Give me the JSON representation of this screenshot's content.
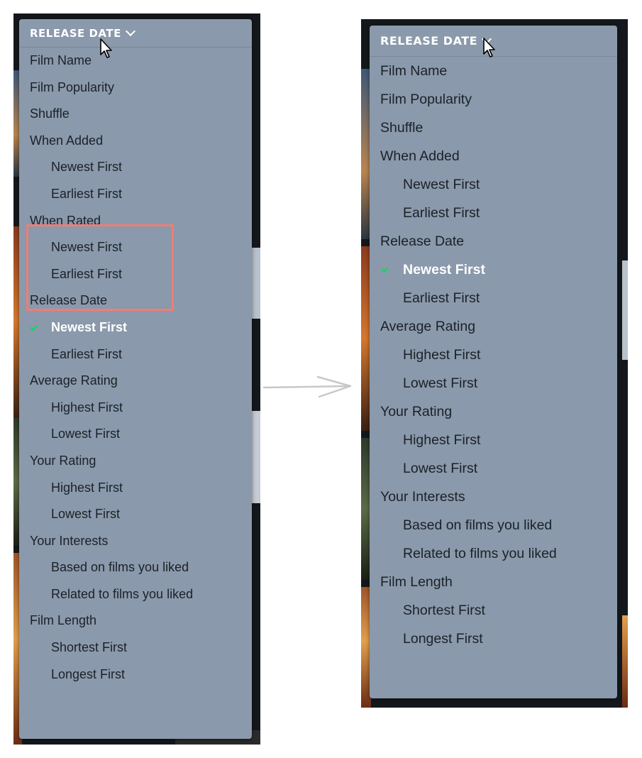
{
  "left_panel": {
    "header_label": "RELEASE DATE",
    "items": [
      {
        "label": "Film Name",
        "type": "group"
      },
      {
        "label": "Film Popularity",
        "type": "group"
      },
      {
        "label": "Shuffle",
        "type": "group"
      },
      {
        "label": "When Added",
        "type": "group"
      },
      {
        "label": "Newest First",
        "type": "sub"
      },
      {
        "label": "Earliest First",
        "type": "sub"
      },
      {
        "label": "When Rated",
        "type": "group"
      },
      {
        "label": "Newest First",
        "type": "sub"
      },
      {
        "label": "Earliest First",
        "type": "sub"
      },
      {
        "label": "Release Date",
        "type": "group"
      },
      {
        "label": "Newest First",
        "type": "sub",
        "selected": true
      },
      {
        "label": "Earliest First",
        "type": "sub"
      },
      {
        "label": "Average Rating",
        "type": "group"
      },
      {
        "label": "Highest First",
        "type": "sub"
      },
      {
        "label": "Lowest First",
        "type": "sub"
      },
      {
        "label": "Your Rating",
        "type": "group"
      },
      {
        "label": "Highest First",
        "type": "sub"
      },
      {
        "label": "Lowest First",
        "type": "sub"
      },
      {
        "label": "Your Interests",
        "type": "group"
      },
      {
        "label": "Based on films you liked",
        "type": "sub"
      },
      {
        "label": "Related to films you liked",
        "type": "sub"
      },
      {
        "label": "Film Length",
        "type": "group"
      },
      {
        "label": "Shortest First",
        "type": "sub"
      },
      {
        "label": "Longest First",
        "type": "sub"
      }
    ]
  },
  "right_panel": {
    "header_label": "RELEASE DATE",
    "items": [
      {
        "label": "Film Name",
        "type": "group"
      },
      {
        "label": "Film Popularity",
        "type": "group"
      },
      {
        "label": "Shuffle",
        "type": "group"
      },
      {
        "label": "When Added",
        "type": "group"
      },
      {
        "label": "Newest First",
        "type": "sub"
      },
      {
        "label": "Earliest First",
        "type": "sub"
      },
      {
        "label": "Release Date",
        "type": "group"
      },
      {
        "label": "Newest First",
        "type": "sub",
        "selected": true
      },
      {
        "label": "Earliest First",
        "type": "sub"
      },
      {
        "label": "Average Rating",
        "type": "group"
      },
      {
        "label": "Highest First",
        "type": "sub"
      },
      {
        "label": "Lowest First",
        "type": "sub"
      },
      {
        "label": "Your Rating",
        "type": "group"
      },
      {
        "label": "Highest First",
        "type": "sub"
      },
      {
        "label": "Lowest First",
        "type": "sub"
      },
      {
        "label": "Your Interests",
        "type": "group"
      },
      {
        "label": "Based on films you liked",
        "type": "sub"
      },
      {
        "label": "Related to films you liked",
        "type": "sub"
      },
      {
        "label": "Film Length",
        "type": "group"
      },
      {
        "label": "Shortest First",
        "type": "sub"
      },
      {
        "label": "Longest First",
        "type": "sub"
      }
    ]
  },
  "icons": {
    "chevron": "chevron-down-icon",
    "check": "check-icon",
    "cursor": "mouse-cursor-icon",
    "arrow": "right-arrow-icon"
  },
  "colors": {
    "menu_bg": "#8a99ab",
    "menu_text": "#1b2128",
    "selected_text": "#ffffff",
    "check_green": "#00e054",
    "highlight_red": "#f07d74",
    "backdrop": "#14181c"
  }
}
